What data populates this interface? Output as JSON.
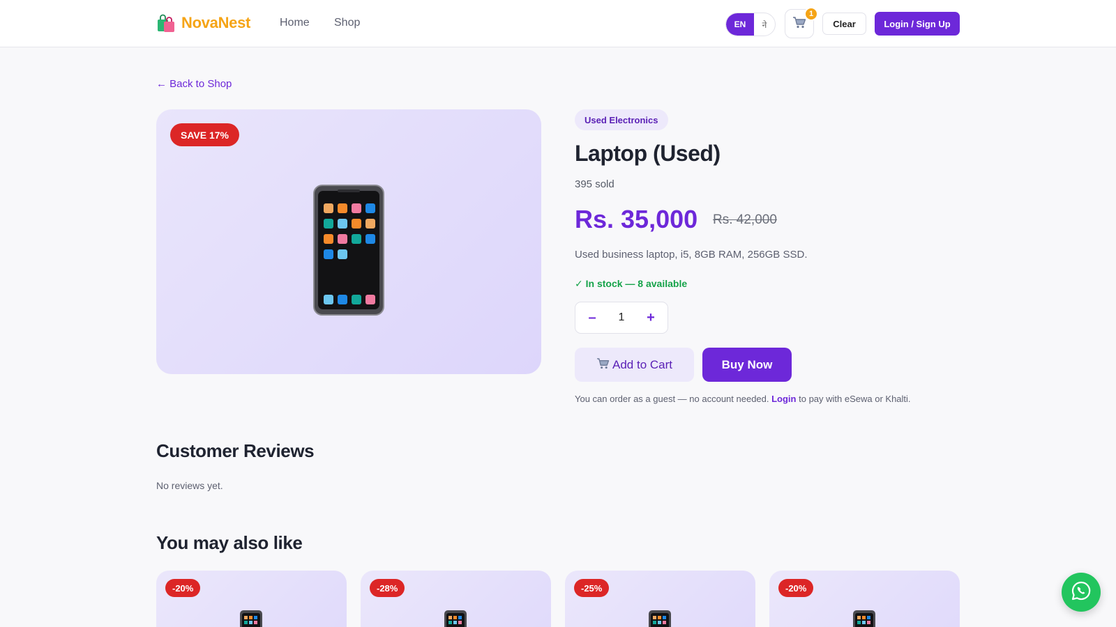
{
  "header": {
    "brand": "NovaNest",
    "nav": {
      "home": "Home",
      "shop": "Shop"
    },
    "lang": {
      "active": "EN",
      "alt": "ने"
    },
    "cart_count": "1",
    "clear_label": "Clear",
    "login_label": "Login / Sign Up"
  },
  "back_label": "← Back to Shop",
  "product": {
    "save_badge": "SAVE 17%",
    "category": "Used Electronics",
    "title": "Laptop (Used)",
    "sold": "395 sold",
    "price": "Rs. 35,000",
    "old_price": "Rs. 42,000",
    "description": "Used business laptop, i5, 8GB RAM, 256GB SSD.",
    "stock": "✓ In stock — 8 available",
    "quantity": "1",
    "qty_minus": "–",
    "qty_plus": "+",
    "add_to_cart": "Add to Cart",
    "buy_now": "Buy Now"
  },
  "guest_note": {
    "before": "You can order as a guest — no account needed. ",
    "link": "Login",
    "after": " to pay with eSewa or Khalti."
  },
  "reviews": {
    "title": "Customer Reviews",
    "empty": "No reviews yet."
  },
  "recommendations": {
    "title": "You may also like",
    "items": [
      {
        "badge": "-20%"
      },
      {
        "badge": "-28%"
      },
      {
        "badge": "-25%"
      },
      {
        "badge": "-20%"
      }
    ]
  },
  "colors": {
    "brand": "#f5a416",
    "accent": "#6d28d9",
    "sale": "#dc2626",
    "stock": "#16a34a",
    "whatsapp": "#22c55e"
  },
  "icons": [
    "shopping-bags-icon",
    "cart-icon",
    "phone-icon",
    "whatsapp-icon"
  ]
}
